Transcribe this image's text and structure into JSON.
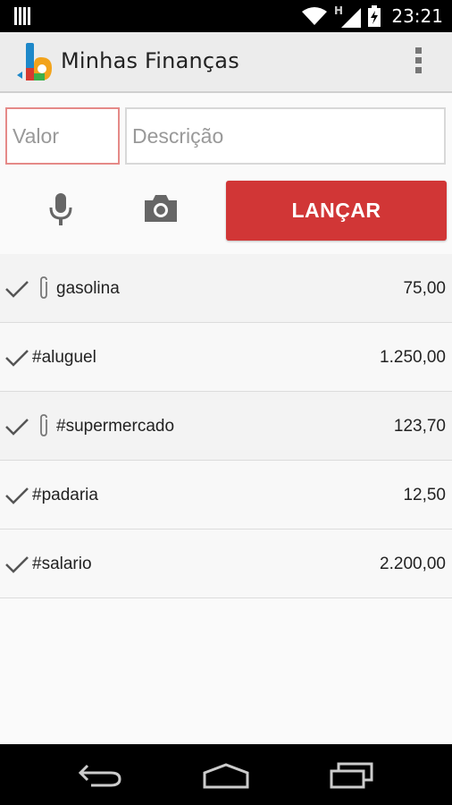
{
  "status_bar": {
    "time": "23:21",
    "network_label": "H",
    "icons": [
      "sim-icon",
      "wifi-icon",
      "signal-icon",
      "battery-charging-icon"
    ]
  },
  "action_bar": {
    "title": "Minhas Finanças",
    "logo": "app-logo-icon",
    "overflow": "overflow-menu-icon"
  },
  "form": {
    "valor_placeholder": "Valor",
    "valor_value": "",
    "descricao_placeholder": "Descrição",
    "descricao_value": "",
    "mic_icon": "microphone-icon",
    "camera_icon": "camera-icon",
    "submit_label": "LANÇAR",
    "submit_color": "#d13636"
  },
  "transactions": [
    {
      "description": "gasolina",
      "amount": "75,00",
      "attachment": true,
      "confirmed": true
    },
    {
      "description": "#aluguel",
      "amount": "1.250,00",
      "attachment": false,
      "confirmed": true
    },
    {
      "description": "#supermercado",
      "amount": "123,70",
      "attachment": true,
      "confirmed": true
    },
    {
      "description": "#padaria",
      "amount": "12,50",
      "attachment": false,
      "confirmed": true
    },
    {
      "description": "#salario",
      "amount": "2.200,00",
      "attachment": false,
      "confirmed": true
    }
  ],
  "nav_bar": {
    "icons": [
      "back-icon",
      "home-icon",
      "recent-apps-icon"
    ]
  }
}
